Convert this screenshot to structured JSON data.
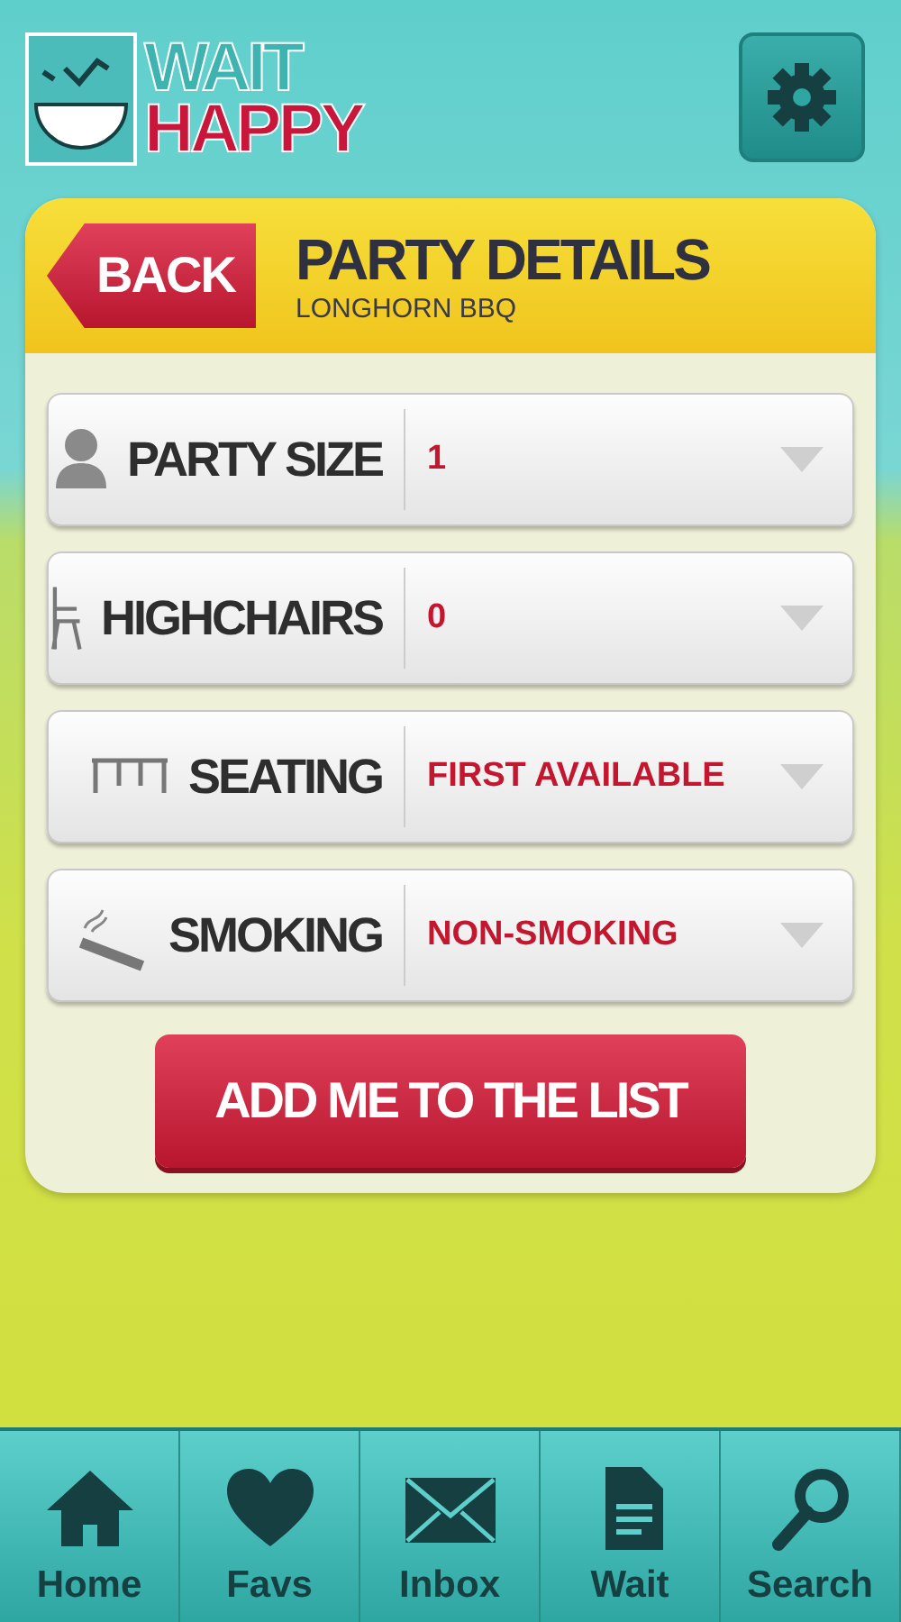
{
  "logo": {
    "line_1": "WAIT",
    "line_2": "HAPPY"
  },
  "panel": {
    "back_button": "BACK",
    "title": "PARTY DETAILS",
    "subtitle": "LONGHORN BBQ"
  },
  "fields": [
    {
      "label": "PARTY SIZE",
      "value": "1"
    },
    {
      "label": "HIGHCHAIRS",
      "value": "0"
    },
    {
      "label": "SEATING",
      "value": "FIRST AVAILABLE"
    },
    {
      "label": "SMOKING",
      "value": "NON-SMOKING"
    }
  ],
  "submit_button": "ADD ME TO THE LIST",
  "tab_bar": [
    {
      "label": "Home"
    },
    {
      "label": "Favs"
    },
    {
      "label": "Inbox"
    },
    {
      "label": "Wait"
    },
    {
      "label": "Search"
    }
  ]
}
